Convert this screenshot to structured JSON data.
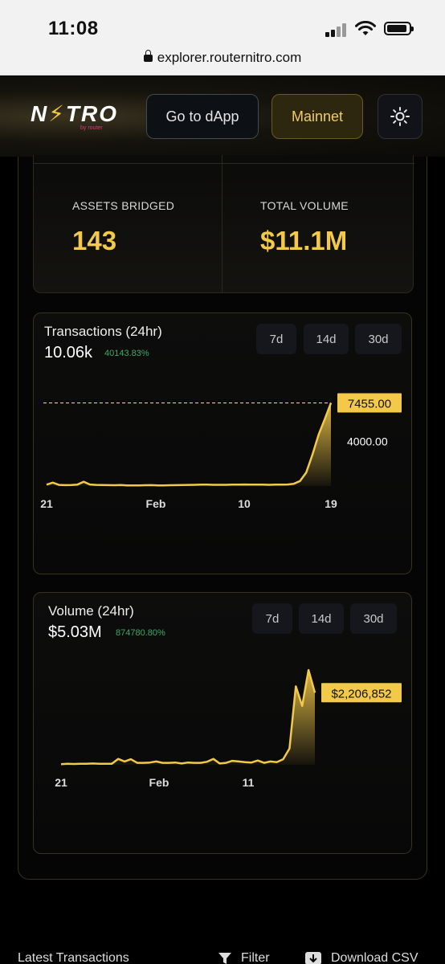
{
  "status_bar": {
    "time": "11:08"
  },
  "browser": {
    "url": "explorer.routernitro.com"
  },
  "header": {
    "logo_text": "N⚡TRO",
    "logo_sub": "by router",
    "dapp_button": "Go to dApp",
    "network_button": "Mainnet",
    "theme_icon": "sun-icon"
  },
  "stats": {
    "assets_label": "ASSETS BRIDGED",
    "assets_value": "143",
    "volume_label": "TOTAL VOLUME",
    "volume_value": "$11.1M"
  },
  "ranges": [
    "7d",
    "14d",
    "30d"
  ],
  "colors": {
    "accent": "#f3c94a",
    "positive": "#3fa866",
    "border": "#3a3219"
  },
  "transactions": {
    "title": "Transactions (24hr)",
    "value": "10.06k",
    "change": "40143.83%"
  },
  "volume": {
    "title": "Volume (24hr)",
    "value": "$5.03M",
    "change": "874780.80%"
  },
  "chart_data": [
    {
      "type": "area",
      "title": "Transactions (24hr)",
      "x_tick_labels": [
        "21",
        "Feb",
        "10",
        "19"
      ],
      "y_tick_labels": [
        "4000.00"
      ],
      "ylim": [
        0,
        8000
      ],
      "current_label": "7455.00",
      "series": [
        {
          "values": [
            120,
            300,
            100,
            80,
            90,
            130,
            380,
            140,
            100,
            90,
            80,
            70,
            90,
            60,
            50,
            60,
            70,
            80,
            60,
            60,
            70,
            80,
            90,
            100,
            110,
            120,
            130,
            110,
            110,
            110,
            120,
            130,
            140,
            130,
            120,
            120,
            110,
            120,
            130,
            140,
            200,
            450,
            1200,
            2800,
            4600,
            6000,
            7455
          ]
        }
      ]
    },
    {
      "type": "area",
      "title": "Volume (24hr)",
      "x_tick_labels": [
        "21",
        "Feb",
        "11"
      ],
      "ylim": [
        0,
        3000000
      ],
      "current_label": "$2,206,852",
      "series": [
        {
          "values": [
            20000,
            30000,
            25000,
            30000,
            30000,
            40000,
            30000,
            30000,
            30000,
            180000,
            100000,
            170000,
            60000,
            60000,
            70000,
            100000,
            60000,
            60000,
            70000,
            40000,
            70000,
            60000,
            60000,
            90000,
            180000,
            40000,
            60000,
            120000,
            100000,
            80000,
            70000,
            130000,
            60000,
            100000,
            80000,
            170000,
            500000,
            2400000,
            1800000,
            2900000,
            2206852
          ]
        }
      ]
    }
  ],
  "bottom": {
    "latest_label": "Latest Transactions",
    "filter_label": "Filter",
    "download_label": "Download CSV"
  }
}
